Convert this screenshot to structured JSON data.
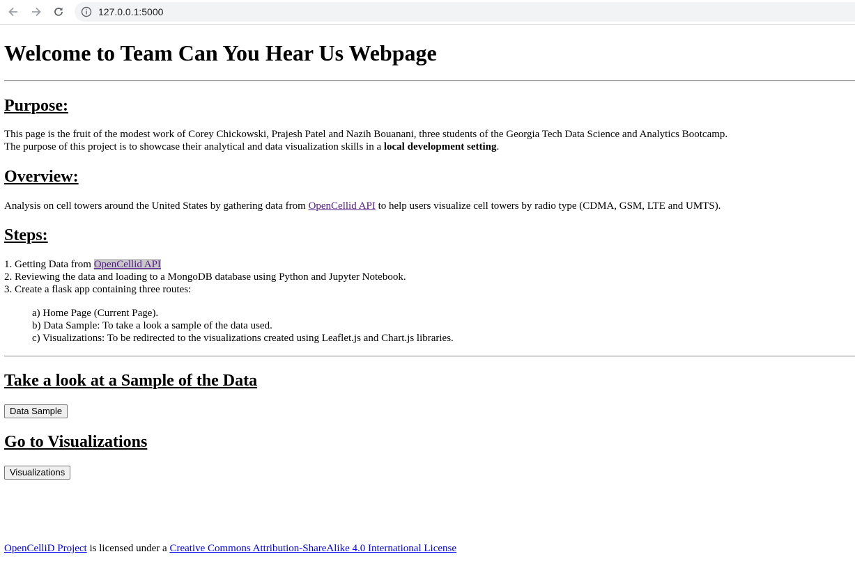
{
  "browser": {
    "url": "127.0.0.1:5000"
  },
  "header": {
    "title": "Welcome to Team Can You Hear Us Webpage"
  },
  "purpose": {
    "heading": "Purpose:",
    "line1": "This page is the fruit of the modest work of Corey Chickowski, Prajesh Patel and Nazih Bouanani, three students of the Georgia Tech Data Science and Analytics Bootcamp.",
    "line2_prefix": "The purpose of this project is to showcase their analytical and data visualization skills in a ",
    "line2_bold": "local development setting",
    "line2_suffix": "."
  },
  "overview": {
    "heading": "Overview:",
    "text_prefix": "Analysis on cell towers around the United States by gathering data from ",
    "link": "OpenCellid API",
    "text_suffix": " to help users visualize cell towers by radio type (CDMA, GSM, LTE and UMTS)."
  },
  "steps": {
    "heading": "Steps:",
    "step1_prefix": "1. Getting Data from ",
    "step1_link": "OpenCellid API",
    "step2": "2. Reviewing the data and loading to a MongoDB database using Python and Jupyter Notebook.",
    "step3": "3. Create a flask app containing three routes:",
    "routes": [
      "a) Home Page (Current Page).",
      "b) Data Sample: To take a look a sample of the data used.",
      "c) Visualizations: To be redirected to the visualizations created using Leaflet.js and Chart.js libraries."
    ]
  },
  "sample": {
    "heading": "Take a look at a Sample of the Data",
    "button": "Data Sample"
  },
  "visualizations": {
    "heading": "Go to Visualizations",
    "button": "Visualizations"
  },
  "footer": {
    "project_link": "OpenCelliD Project",
    "middle": " is licensed under a ",
    "license_link": "Creative Commons Attribution-ShareAlike 4.0 International License"
  }
}
